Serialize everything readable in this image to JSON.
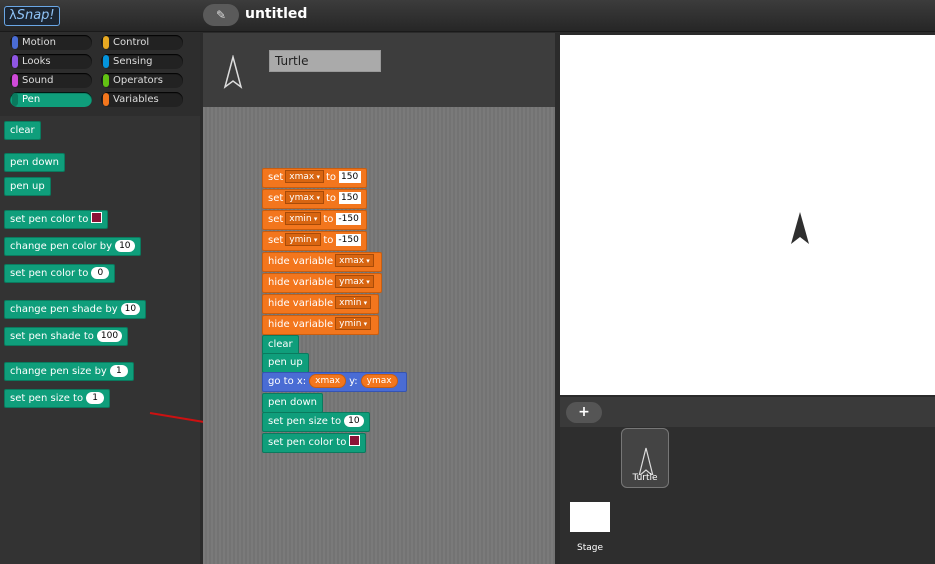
{
  "app": {
    "logo_text": "Snap!",
    "project_title": "untitled",
    "edit_icon": "pencil-icon"
  },
  "categories": [
    {
      "label": "Motion",
      "color": "#4a6cd4"
    },
    {
      "label": "Control",
      "color": "#e6a822"
    },
    {
      "label": "Looks",
      "color": "#8f56e3"
    },
    {
      "label": "Sensing",
      "color": "#0494dc"
    },
    {
      "label": "Sound",
      "color": "#cf4ad9"
    },
    {
      "label": "Operators",
      "color": "#62c213"
    },
    {
      "label": "Pen",
      "color": "#0f9e7b"
    },
    {
      "label": "Variables",
      "color": "#f3761d"
    }
  ],
  "palette": {
    "clear": "clear",
    "pen_down": "pen down",
    "pen_up": "pen up",
    "set_pen_color": "set pen color to",
    "change_pen_color": {
      "label": "change pen color by",
      "value": "10"
    },
    "set_pen_color_num": {
      "label": "set pen color to",
      "value": "0"
    },
    "change_pen_shade": {
      "label": "change pen shade by",
      "value": "10"
    },
    "set_pen_shade": {
      "label": "set pen shade to",
      "value": "100"
    },
    "change_pen_size": {
      "label": "change pen size by",
      "value": "1"
    },
    "set_pen_size": {
      "label": "set pen size to",
      "value": "1"
    }
  },
  "sprite": {
    "name": "Turtle"
  },
  "script": {
    "kw_set": "set",
    "kw_to": "to",
    "kw_hide": "hide variable",
    "sets": [
      {
        "var": "xmax",
        "value": "150"
      },
      {
        "var": "ymax",
        "value": "150"
      },
      {
        "var": "xmin",
        "value": "-150"
      },
      {
        "var": "ymin",
        "value": "-150"
      }
    ],
    "hides": [
      "xmax",
      "ymax",
      "xmin",
      "ymin"
    ],
    "clear": "clear",
    "pen_up": "pen up",
    "goto": {
      "label_x": "go to x:",
      "x": "xmax",
      "label_y": "y:",
      "y": "ymax"
    },
    "pen_down": "pen down",
    "set_pen_size": {
      "label": "set pen size to",
      "value": "10"
    },
    "set_pen_color": "set pen color to"
  },
  "corral": {
    "add_icon": "plus-icon",
    "add_label": "+",
    "sprite_label": "Turtle",
    "stage_label": "Stage"
  },
  "colors": {
    "pen_color_swatch": "#8a1236",
    "arrow": "#cc1111"
  }
}
